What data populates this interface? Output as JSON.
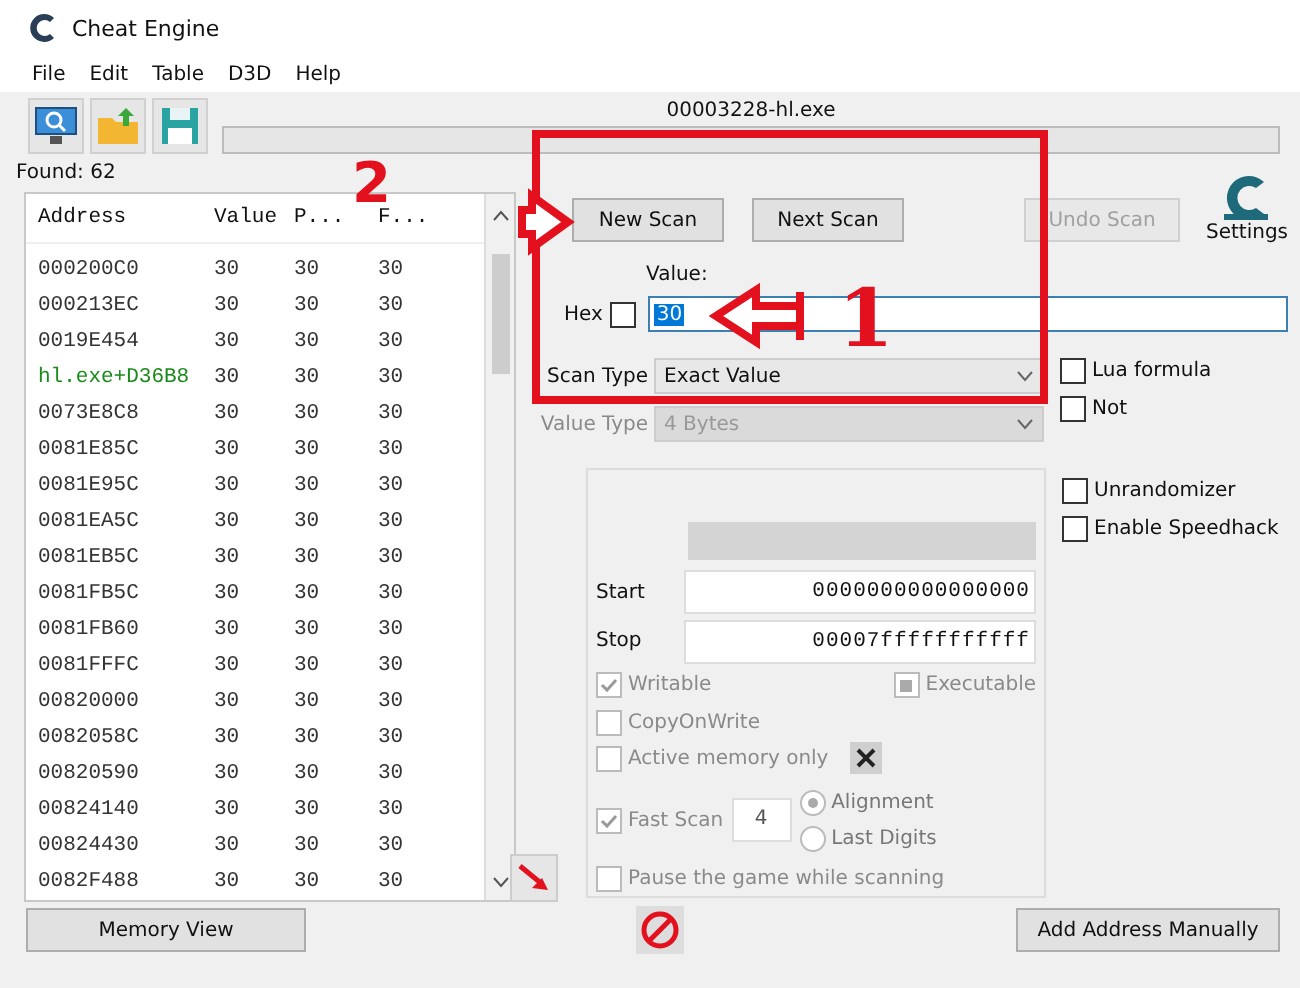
{
  "window": {
    "title": "Cheat Engine"
  },
  "menu": [
    "File",
    "Edit",
    "Table",
    "D3D",
    "Help"
  ],
  "process": "00003228-hl.exe",
  "found": "Found: 62",
  "results": {
    "columns": [
      "Address",
      "Value",
      "P...",
      "F..."
    ],
    "rows": [
      {
        "address": "000200C0",
        "values": [
          "30",
          "30",
          "30"
        ],
        "static": false
      },
      {
        "address": "000213EC",
        "values": [
          "30",
          "30",
          "30"
        ],
        "static": false
      },
      {
        "address": "0019E454",
        "values": [
          "30",
          "30",
          "30"
        ],
        "static": false
      },
      {
        "address": "hl.exe+D36B8",
        "values": [
          "30",
          "30",
          "30"
        ],
        "static": true
      },
      {
        "address": "0073E8C8",
        "values": [
          "30",
          "30",
          "30"
        ],
        "static": false
      },
      {
        "address": "0081E85C",
        "values": [
          "30",
          "30",
          "30"
        ],
        "static": false
      },
      {
        "address": "0081E95C",
        "values": [
          "30",
          "30",
          "30"
        ],
        "static": false
      },
      {
        "address": "0081EA5C",
        "values": [
          "30",
          "30",
          "30"
        ],
        "static": false
      },
      {
        "address": "0081EB5C",
        "values": [
          "30",
          "30",
          "30"
        ],
        "static": false
      },
      {
        "address": "0081FB5C",
        "values": [
          "30",
          "30",
          "30"
        ],
        "static": false
      },
      {
        "address": "0081FB60",
        "values": [
          "30",
          "30",
          "30"
        ],
        "static": false
      },
      {
        "address": "0081FFFC",
        "values": [
          "30",
          "30",
          "30"
        ],
        "static": false
      },
      {
        "address": "00820000",
        "values": [
          "30",
          "30",
          "30"
        ],
        "static": false
      },
      {
        "address": "0082058C",
        "values": [
          "30",
          "30",
          "30"
        ],
        "static": false
      },
      {
        "address": "00820590",
        "values": [
          "30",
          "30",
          "30"
        ],
        "static": false
      },
      {
        "address": "00824140",
        "values": [
          "30",
          "30",
          "30"
        ],
        "static": false
      },
      {
        "address": "00824430",
        "values": [
          "30",
          "30",
          "30"
        ],
        "static": false
      },
      {
        "address": "0082F488",
        "values": [
          "30",
          "30",
          "30"
        ],
        "static": false
      }
    ]
  },
  "scan": {
    "buttons": [
      {
        "label": "New Scan",
        "disabled": false
      },
      {
        "label": "Next Scan",
        "disabled": false
      },
      {
        "label": "Undo Scan",
        "disabled": true
      }
    ],
    "settings": "Settings",
    "value_label": "Value:",
    "hex": {
      "label": "Hex",
      "checked": false
    },
    "value": "30",
    "scan_type": {
      "label": "Scan Type",
      "value": "Exact Value",
      "disabled": false
    },
    "value_type": {
      "label": "Value Type",
      "value": "4 Bytes",
      "disabled": true
    },
    "side_options": [
      {
        "label": "Lua formula",
        "checked": false
      },
      {
        "label": "Not",
        "checked": false
      }
    ],
    "extra_options": [
      {
        "label": "Unrandomizer",
        "checked": false
      },
      {
        "label": "Enable Speedhack",
        "checked": false
      }
    ]
  },
  "memory": {
    "start": {
      "label": "Start",
      "value": "0000000000000000"
    },
    "stop": {
      "label": "Stop",
      "value": "00007fffffffffff"
    },
    "writable": {
      "label": "Writable",
      "checked": true
    },
    "executable": {
      "label": "Executable",
      "indeterminate": true
    },
    "copy_on_write": {
      "label": "CopyOnWrite",
      "checked": false
    },
    "active_only": {
      "label": "Active memory only",
      "checked": false
    },
    "fast_scan": {
      "label": "Fast Scan",
      "checked": true,
      "digits": "4",
      "modes": [
        {
          "label": "Alignment",
          "selected": true
        },
        {
          "label": "Last Digits",
          "selected": false
        }
      ]
    },
    "pause": {
      "label": "Pause the game while scanning",
      "checked": false
    }
  },
  "bottom": {
    "memory_view": "Memory View",
    "add_address": "Add Address Manually"
  },
  "annotations": [
    {
      "label": "2"
    },
    {
      "label": "1"
    }
  ]
}
